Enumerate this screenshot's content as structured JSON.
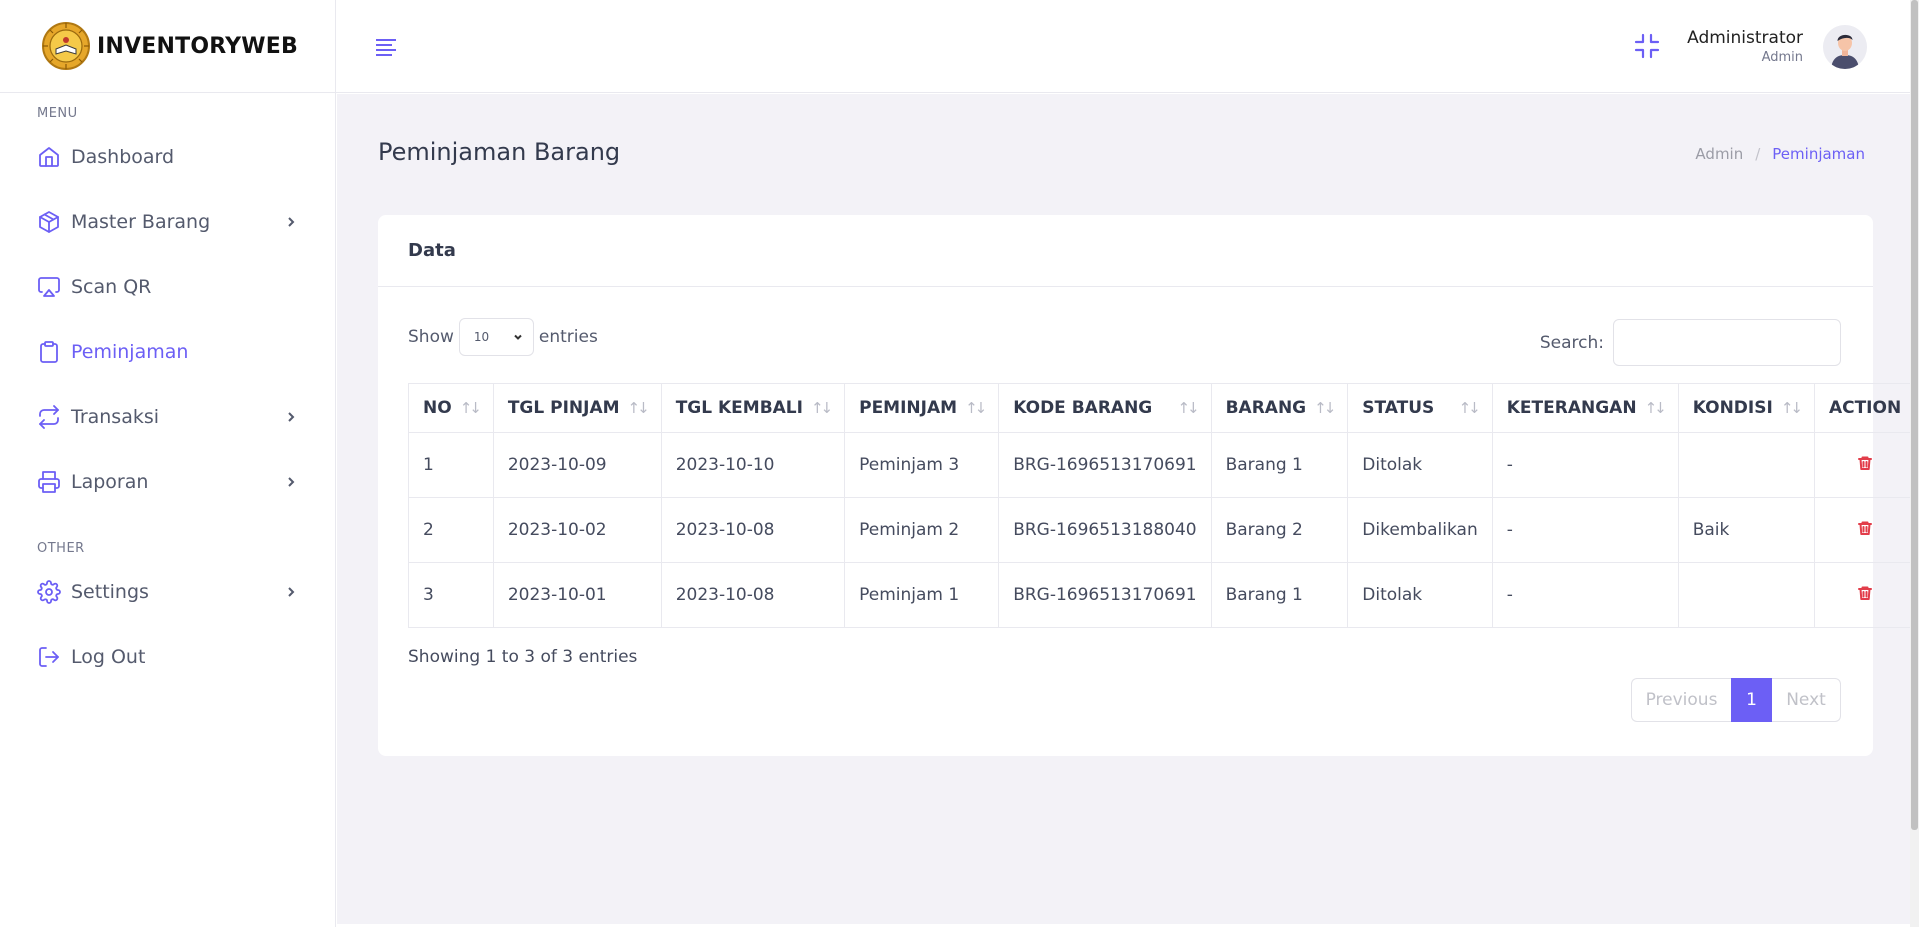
{
  "brand": {
    "name": "INVENTORYWEB"
  },
  "sidebar": {
    "menu_title": "MENU",
    "other_title": "OTHER",
    "items": [
      {
        "label": "Dashboard",
        "icon": "home-icon",
        "has_children": false,
        "active": false
      },
      {
        "label": "Master Barang",
        "icon": "box-icon",
        "has_children": true,
        "active": false
      },
      {
        "label": "Scan QR",
        "icon": "airplay-icon",
        "has_children": false,
        "active": false
      },
      {
        "label": "Peminjaman",
        "icon": "clipboard-icon",
        "has_children": false,
        "active": true
      },
      {
        "label": "Transaksi",
        "icon": "repeat-icon",
        "has_children": true,
        "active": false
      },
      {
        "label": "Laporan",
        "icon": "printer-icon",
        "has_children": true,
        "active": false
      }
    ],
    "other_items": [
      {
        "label": "Settings",
        "icon": "gear-icon",
        "has_children": true
      },
      {
        "label": "Log Out",
        "icon": "logout-icon",
        "has_children": false
      }
    ]
  },
  "topbar": {
    "user_name": "Administrator",
    "user_role": "Admin"
  },
  "page": {
    "title": "Peminjaman Barang",
    "breadcrumb": {
      "root": "Admin",
      "separator": "/",
      "current": "Peminjaman"
    }
  },
  "card": {
    "title": "Data",
    "show_label": "Show",
    "entries_label": "entries",
    "page_length": "10",
    "search_label": "Search:",
    "search_value": ""
  },
  "table": {
    "columns": [
      "NO",
      "TGL PINJAM",
      "TGL KEMBALI",
      "PEMINJAM",
      "KODE BARANG",
      "BARANG",
      "STATUS",
      "KETERANGAN",
      "KONDISI",
      "ACTION"
    ],
    "rows": [
      {
        "no": "1",
        "tgl_pinjam": "2023-10-09",
        "tgl_kembali": "2023-10-10",
        "peminjam": "Peminjam 3",
        "kode_barang": "BRG-1696513170691",
        "barang": "Barang 1",
        "status": "Ditolak",
        "keterangan": "-",
        "kondisi": ""
      },
      {
        "no": "2",
        "tgl_pinjam": "2023-10-02",
        "tgl_kembali": "2023-10-08",
        "peminjam": "Peminjam 2",
        "kode_barang": "BRG-1696513188040",
        "barang": "Barang 2",
        "status": "Dikembalikan",
        "keterangan": "-",
        "kondisi": "Baik"
      },
      {
        "no": "3",
        "tgl_pinjam": "2023-10-01",
        "tgl_kembali": "2023-10-08",
        "peminjam": "Peminjam 1",
        "kode_barang": "BRG-1696513170691",
        "barang": "Barang 1",
        "status": "Ditolak",
        "keterangan": "-",
        "kondisi": ""
      }
    ]
  },
  "footer": {
    "info": "Showing 1 to 3 of 3 entries",
    "previous": "Previous",
    "current_page": "1",
    "next": "Next"
  },
  "colors": {
    "accent": "#6c5ff5",
    "danger": "#e23d4a",
    "background": "#f3f2f7"
  }
}
